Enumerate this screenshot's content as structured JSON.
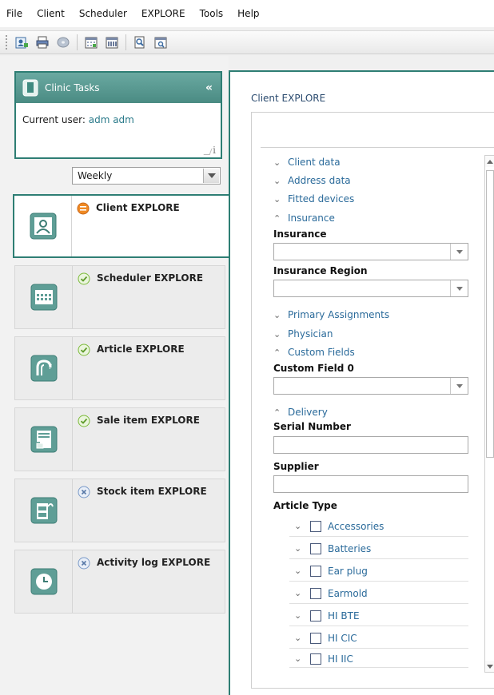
{
  "menu": [
    "File",
    "Client",
    "Scheduler",
    "EXPLORE",
    "Tools",
    "Help"
  ],
  "toolbar": {
    "icons": [
      "new-client-icon",
      "print-icon",
      "disc-icon",
      "calendar-icon",
      "calendar-week-icon",
      "find-icon",
      "search-calendar-icon"
    ]
  },
  "tasks": {
    "title": "Clinic Tasks",
    "collapse": "«",
    "user_label": "Current user:",
    "user_value": "adm adm",
    "info": "i"
  },
  "view_select": {
    "value": "Weekly"
  },
  "modules": [
    {
      "label": "Client EXPLORE",
      "status": "minus",
      "icon": "client-icon",
      "active": true
    },
    {
      "label": "Scheduler EXPLORE",
      "status": "check",
      "icon": "scheduler-icon"
    },
    {
      "label": "Article EXPLORE",
      "status": "check",
      "icon": "hearing-aid-icon"
    },
    {
      "label": "Sale item EXPLORE",
      "status": "check",
      "icon": "sale-item-icon"
    },
    {
      "label": "Stock item EXPLORE",
      "status": "x",
      "icon": "stock-item-icon"
    },
    {
      "label": "Activity log EXPLORE",
      "status": "x",
      "icon": "clock-icon"
    }
  ],
  "main": {
    "title": "Client EXPLORE",
    "sections": {
      "client_data": "Client data",
      "address_data": "Address data",
      "fitted_devices": "Fitted devices",
      "insurance": "Insurance",
      "primary_assignments": "Primary Assignments",
      "physician": "Physician",
      "custom_fields": "Custom Fields",
      "delivery": "Delivery"
    },
    "labels": {
      "insurance": "Insurance",
      "insurance_region": "Insurance Region",
      "custom_field_0": "Custom Field 0",
      "serial_number": "Serial Number",
      "supplier": "Supplier",
      "article_type": "Article Type"
    },
    "article_types": [
      "Accessories",
      "Batteries",
      "Ear plug",
      "Earmold",
      "HI BTE",
      "HI CIC",
      "HI IIC"
    ]
  },
  "colors": {
    "accent": "#2e7e74",
    "link": "#2a6a9a",
    "status_minus": "#f08a24",
    "status_check": "#7dbb3c",
    "status_x": "#7a9ac8"
  }
}
